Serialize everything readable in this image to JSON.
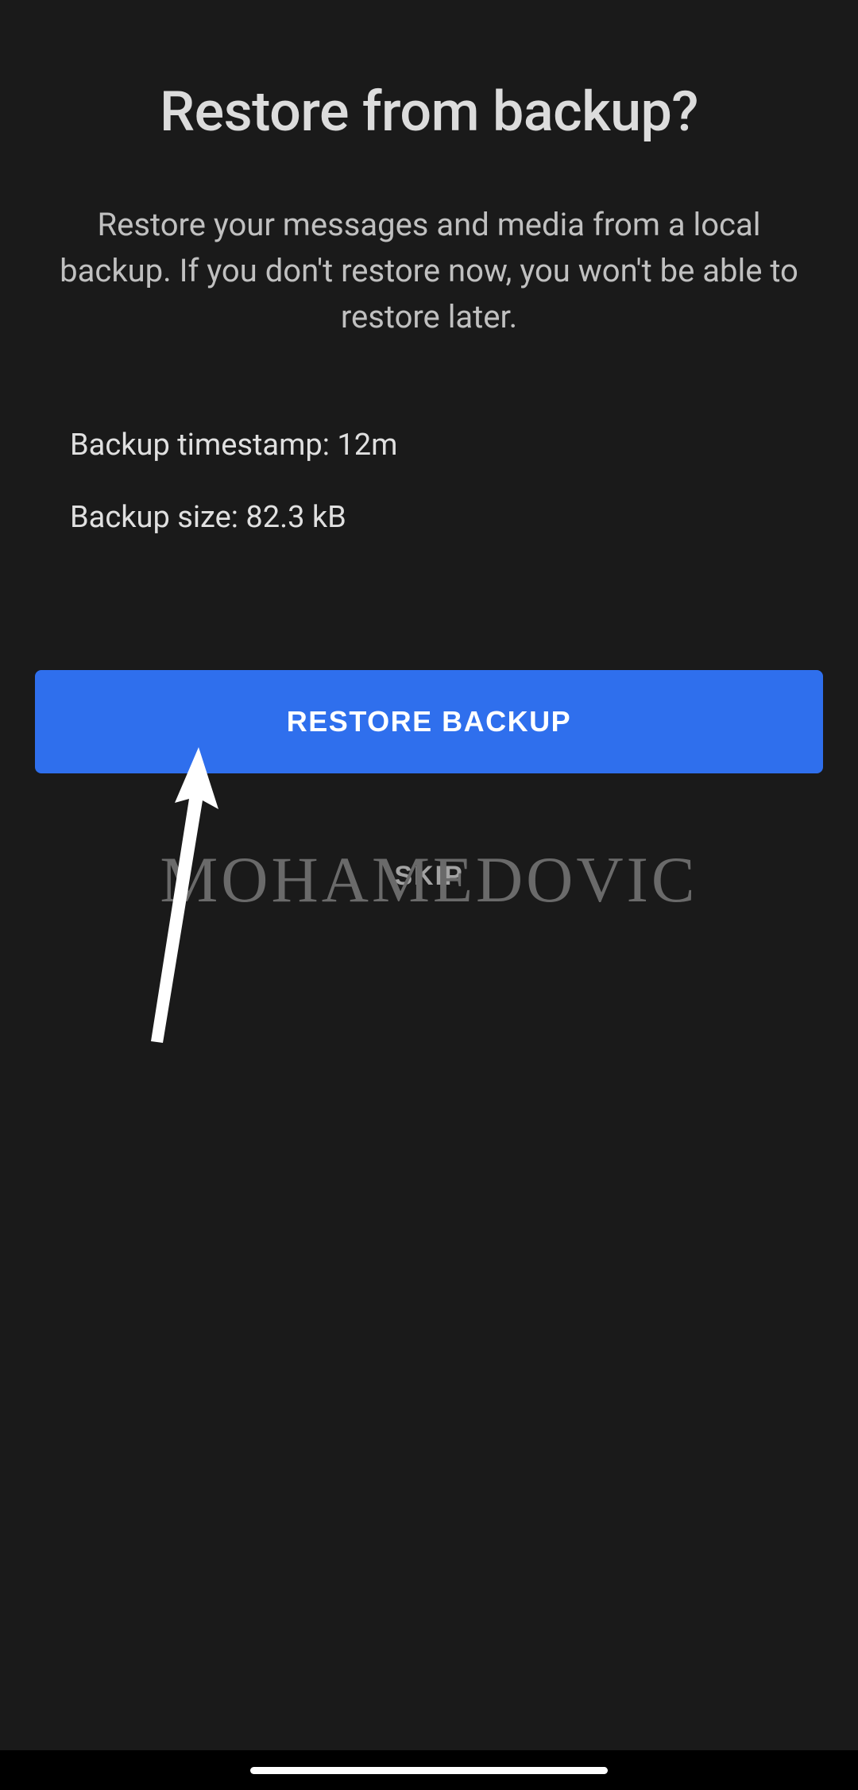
{
  "header": {
    "title": "Restore from backup?"
  },
  "description": "Restore your messages and media from a local backup. If you don't restore now, you won't be able to restore later.",
  "info": {
    "timestamp_label": "Backup timestamp: ",
    "timestamp_value": "12m",
    "size_label": "Backup size: ",
    "size_value": "82.3 kB"
  },
  "buttons": {
    "restore_label": "RESTORE BACKUP",
    "skip_label": "SKIP"
  },
  "watermark": "MOHAMEDOVIC"
}
